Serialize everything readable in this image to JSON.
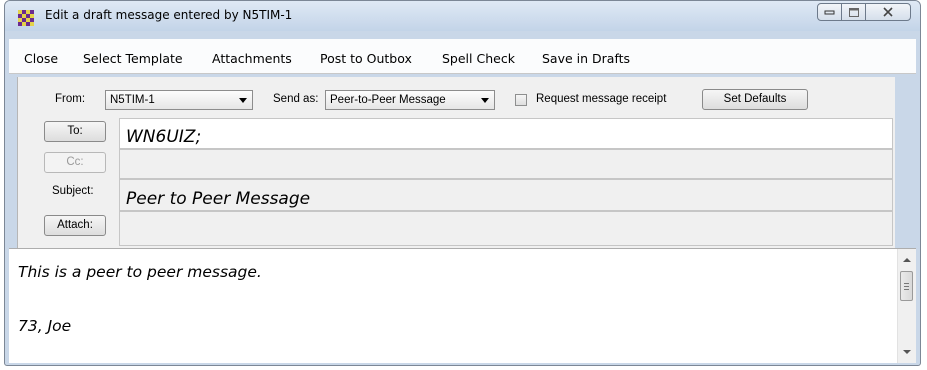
{
  "window": {
    "title": "Edit a draft message entered by N5TIM-1",
    "icon": "checkered-message-icon",
    "controls": [
      "minimize-icon",
      "maximize-icon",
      "close-icon"
    ]
  },
  "menu": {
    "close": "Close",
    "select_template": "Select Template",
    "attachments": "Attachments",
    "post_to_outbox": "Post to Outbox",
    "spell_check": "Spell Check",
    "save_in_drafts": "Save in Drafts"
  },
  "header": {
    "from_label": "From:",
    "from_value": "N5TIM-1",
    "send_as_label": "Send as:",
    "send_as_value": "Peer-to-Peer Message",
    "request_receipt_label": "Request message receipt",
    "request_receipt_checked": false,
    "set_defaults_label": "Set Defaults",
    "to_button": "To:",
    "to_value": "WN6UIZ;",
    "cc_button": "Cc:",
    "cc_value": "",
    "subject_label": "Subject:",
    "subject_value": "Peer to Peer Message",
    "attach_button": "Attach:",
    "attach_value": ""
  },
  "body": {
    "line1": "This is a peer to peer message.",
    "line2": "73, Joe"
  },
  "colors": {
    "frame": "#c9d7e8",
    "panel": "#f0f0f0",
    "field_white": "#ffffff"
  }
}
